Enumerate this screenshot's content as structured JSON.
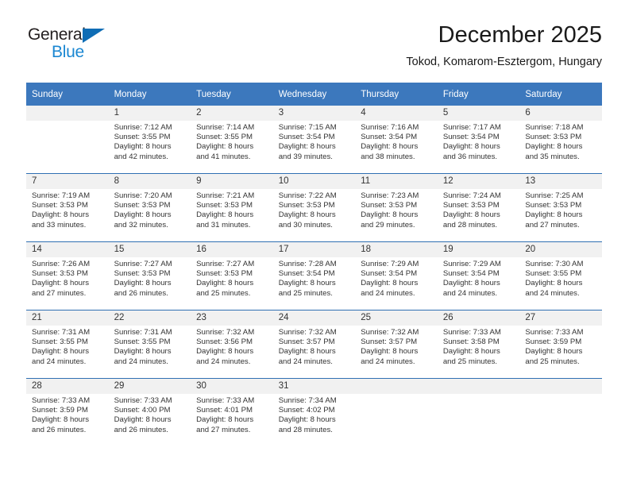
{
  "brand": {
    "name_top": "General",
    "name_bottom": "Blue",
    "accent_color": "#1b87d2",
    "triangle_color": "#0f6db5"
  },
  "header": {
    "title": "December 2025",
    "subtitle": "Tokod, Komarom-Esztergom, Hungary",
    "header_bg": "#3c78bd",
    "daynum_bg": "#f1f1f1",
    "separator_color": "#3070b3"
  },
  "weekdays": [
    "Sunday",
    "Monday",
    "Tuesday",
    "Wednesday",
    "Thursday",
    "Friday",
    "Saturday"
  ],
  "weeks": [
    [
      {
        "day": "",
        "lines": [
          "",
          "",
          "",
          ""
        ]
      },
      {
        "day": "1",
        "lines": [
          "Sunrise: 7:12 AM",
          "Sunset: 3:55 PM",
          "Daylight: 8 hours",
          "and 42 minutes."
        ]
      },
      {
        "day": "2",
        "lines": [
          "Sunrise: 7:14 AM",
          "Sunset: 3:55 PM",
          "Daylight: 8 hours",
          "and 41 minutes."
        ]
      },
      {
        "day": "3",
        "lines": [
          "Sunrise: 7:15 AM",
          "Sunset: 3:54 PM",
          "Daylight: 8 hours",
          "and 39 minutes."
        ]
      },
      {
        "day": "4",
        "lines": [
          "Sunrise: 7:16 AM",
          "Sunset: 3:54 PM",
          "Daylight: 8 hours",
          "and 38 minutes."
        ]
      },
      {
        "day": "5",
        "lines": [
          "Sunrise: 7:17 AM",
          "Sunset: 3:54 PM",
          "Daylight: 8 hours",
          "and 36 minutes."
        ]
      },
      {
        "day": "6",
        "lines": [
          "Sunrise: 7:18 AM",
          "Sunset: 3:53 PM",
          "Daylight: 8 hours",
          "and 35 minutes."
        ]
      }
    ],
    [
      {
        "day": "7",
        "lines": [
          "Sunrise: 7:19 AM",
          "Sunset: 3:53 PM",
          "Daylight: 8 hours",
          "and 33 minutes."
        ]
      },
      {
        "day": "8",
        "lines": [
          "Sunrise: 7:20 AM",
          "Sunset: 3:53 PM",
          "Daylight: 8 hours",
          "and 32 minutes."
        ]
      },
      {
        "day": "9",
        "lines": [
          "Sunrise: 7:21 AM",
          "Sunset: 3:53 PM",
          "Daylight: 8 hours",
          "and 31 minutes."
        ]
      },
      {
        "day": "10",
        "lines": [
          "Sunrise: 7:22 AM",
          "Sunset: 3:53 PM",
          "Daylight: 8 hours",
          "and 30 minutes."
        ]
      },
      {
        "day": "11",
        "lines": [
          "Sunrise: 7:23 AM",
          "Sunset: 3:53 PM",
          "Daylight: 8 hours",
          "and 29 minutes."
        ]
      },
      {
        "day": "12",
        "lines": [
          "Sunrise: 7:24 AM",
          "Sunset: 3:53 PM",
          "Daylight: 8 hours",
          "and 28 minutes."
        ]
      },
      {
        "day": "13",
        "lines": [
          "Sunrise: 7:25 AM",
          "Sunset: 3:53 PM",
          "Daylight: 8 hours",
          "and 27 minutes."
        ]
      }
    ],
    [
      {
        "day": "14",
        "lines": [
          "Sunrise: 7:26 AM",
          "Sunset: 3:53 PM",
          "Daylight: 8 hours",
          "and 27 minutes."
        ]
      },
      {
        "day": "15",
        "lines": [
          "Sunrise: 7:27 AM",
          "Sunset: 3:53 PM",
          "Daylight: 8 hours",
          "and 26 minutes."
        ]
      },
      {
        "day": "16",
        "lines": [
          "Sunrise: 7:27 AM",
          "Sunset: 3:53 PM",
          "Daylight: 8 hours",
          "and 25 minutes."
        ]
      },
      {
        "day": "17",
        "lines": [
          "Sunrise: 7:28 AM",
          "Sunset: 3:54 PM",
          "Daylight: 8 hours",
          "and 25 minutes."
        ]
      },
      {
        "day": "18",
        "lines": [
          "Sunrise: 7:29 AM",
          "Sunset: 3:54 PM",
          "Daylight: 8 hours",
          "and 24 minutes."
        ]
      },
      {
        "day": "19",
        "lines": [
          "Sunrise: 7:29 AM",
          "Sunset: 3:54 PM",
          "Daylight: 8 hours",
          "and 24 minutes."
        ]
      },
      {
        "day": "20",
        "lines": [
          "Sunrise: 7:30 AM",
          "Sunset: 3:55 PM",
          "Daylight: 8 hours",
          "and 24 minutes."
        ]
      }
    ],
    [
      {
        "day": "21",
        "lines": [
          "Sunrise: 7:31 AM",
          "Sunset: 3:55 PM",
          "Daylight: 8 hours",
          "and 24 minutes."
        ]
      },
      {
        "day": "22",
        "lines": [
          "Sunrise: 7:31 AM",
          "Sunset: 3:55 PM",
          "Daylight: 8 hours",
          "and 24 minutes."
        ]
      },
      {
        "day": "23",
        "lines": [
          "Sunrise: 7:32 AM",
          "Sunset: 3:56 PM",
          "Daylight: 8 hours",
          "and 24 minutes."
        ]
      },
      {
        "day": "24",
        "lines": [
          "Sunrise: 7:32 AM",
          "Sunset: 3:57 PM",
          "Daylight: 8 hours",
          "and 24 minutes."
        ]
      },
      {
        "day": "25",
        "lines": [
          "Sunrise: 7:32 AM",
          "Sunset: 3:57 PM",
          "Daylight: 8 hours",
          "and 24 minutes."
        ]
      },
      {
        "day": "26",
        "lines": [
          "Sunrise: 7:33 AM",
          "Sunset: 3:58 PM",
          "Daylight: 8 hours",
          "and 25 minutes."
        ]
      },
      {
        "day": "27",
        "lines": [
          "Sunrise: 7:33 AM",
          "Sunset: 3:59 PM",
          "Daylight: 8 hours",
          "and 25 minutes."
        ]
      }
    ],
    [
      {
        "day": "28",
        "lines": [
          "Sunrise: 7:33 AM",
          "Sunset: 3:59 PM",
          "Daylight: 8 hours",
          "and 26 minutes."
        ]
      },
      {
        "day": "29",
        "lines": [
          "Sunrise: 7:33 AM",
          "Sunset: 4:00 PM",
          "Daylight: 8 hours",
          "and 26 minutes."
        ]
      },
      {
        "day": "30",
        "lines": [
          "Sunrise: 7:33 AM",
          "Sunset: 4:01 PM",
          "Daylight: 8 hours",
          "and 27 minutes."
        ]
      },
      {
        "day": "31",
        "lines": [
          "Sunrise: 7:34 AM",
          "Sunset: 4:02 PM",
          "Daylight: 8 hours",
          "and 28 minutes."
        ]
      },
      {
        "day": "",
        "lines": [
          "",
          "",
          "",
          ""
        ]
      },
      {
        "day": "",
        "lines": [
          "",
          "",
          "",
          ""
        ]
      },
      {
        "day": "",
        "lines": [
          "",
          "",
          "",
          ""
        ]
      }
    ]
  ]
}
